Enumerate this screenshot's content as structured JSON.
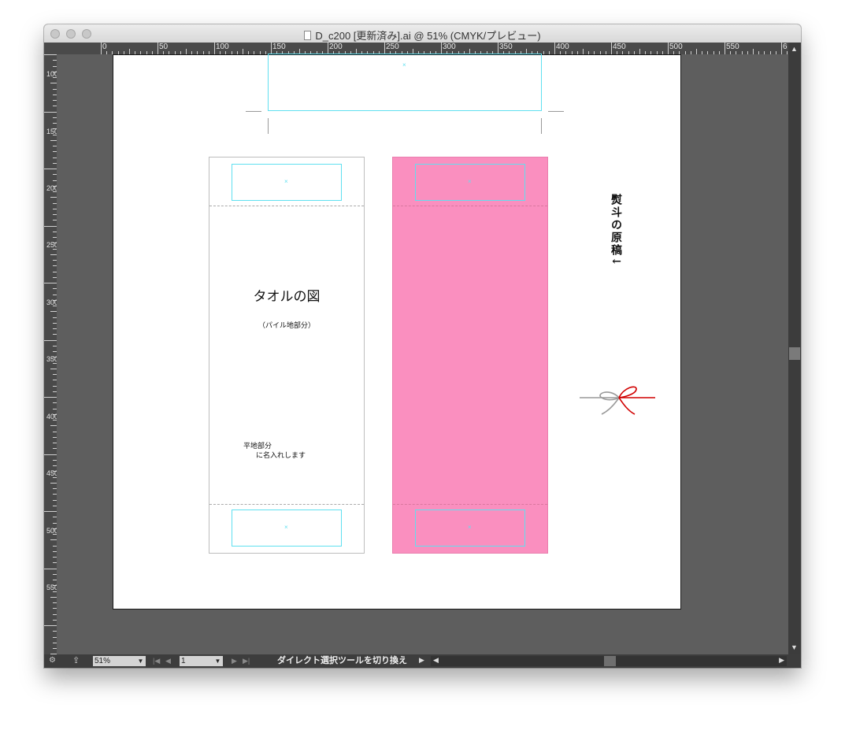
{
  "window": {
    "title": "D_c200 [更新済み].ai @ 51% (CMYK/プレビュー)"
  },
  "ruler_top": {
    "labels": [
      "0",
      "50",
      "100",
      "150",
      "200",
      "250",
      "300",
      "350",
      "400",
      "450",
      "500",
      "550",
      "6"
    ]
  },
  "ruler_left": {
    "labels": [
      "100",
      "150",
      "200",
      "250",
      "300",
      "350",
      "400",
      "450",
      "500",
      "550"
    ]
  },
  "artboard": {
    "towel_title": "タオルの図",
    "pile_note": "（パイル地部分）",
    "flat_note_line1": "平地部分",
    "flat_note_line2": "に名入れします",
    "noshi_label": "熨斗の原稿↓",
    "xmark": "×",
    "towel_color": "#fa8fbf",
    "guide_color": "#5fe0f0"
  },
  "status_bar": {
    "zoom": "51%",
    "artboard_number": "1",
    "current_tool": "ダイレクト選択ツールを切り換え"
  }
}
